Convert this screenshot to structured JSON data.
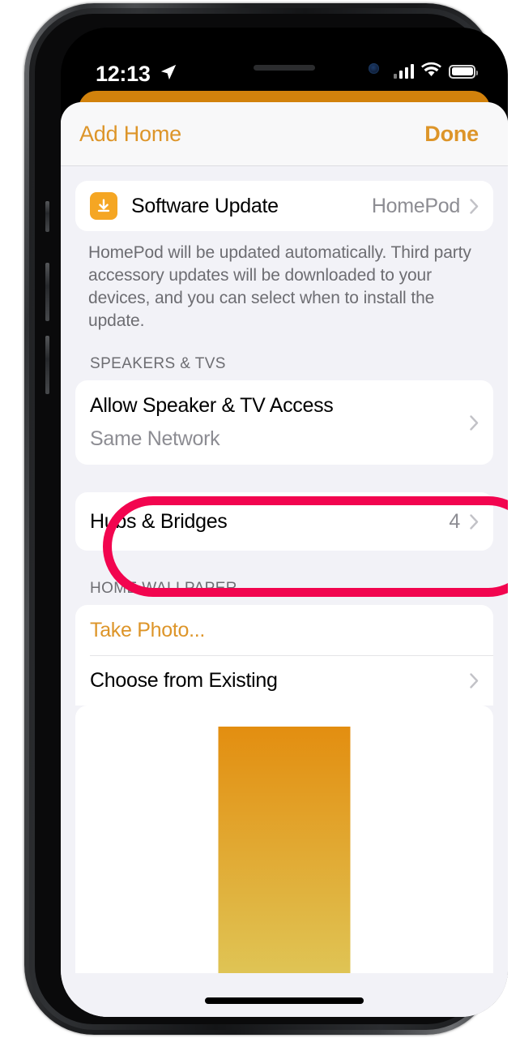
{
  "status_bar": {
    "time": "12:13",
    "location_icon": "location-arrow-icon",
    "signal_icon": "cellular-signal-icon",
    "signal_bars": 4,
    "wifi_icon": "wifi-icon",
    "battery_icon": "battery-full-icon"
  },
  "nav": {
    "title": "Add Home",
    "done_label": "Done"
  },
  "sections": [
    {
      "id": "software-update",
      "header": "",
      "rows": [
        {
          "title": "Software Update",
          "value": "HomePod",
          "icon": "software-update-download-icon",
          "chevron": true
        }
      ],
      "footer": "HomePod will be updated automatically. Third party accessory updates will be downloaded to your devices, and you can select when to install the update."
    },
    {
      "id": "speakers-and-tvs",
      "header": "SPEAKERS & TVS",
      "rows": [
        {
          "title": "Allow Speaker & TV Access",
          "subtitle": "Same Network",
          "chevron": true
        }
      ],
      "footer": ""
    },
    {
      "id": "hubs-and-bridges",
      "header": "",
      "rows": [
        {
          "title": "Hubs & Bridges",
          "value": "4",
          "chevron": true
        }
      ],
      "footer": ""
    },
    {
      "id": "home-wallpaper",
      "header": "HOME WALLPAPER",
      "rows": [
        {
          "title": "Take Photo...",
          "accent": true,
          "chevron": false
        },
        {
          "title": "Choose from Existing",
          "chevron": true
        }
      ],
      "footer": ""
    }
  ],
  "wallpaper_preview": {
    "name": "orange-gradient-wallpaper",
    "gradient_top": "#e38e10",
    "gradient_bottom": "#dfc556"
  },
  "annotation": {
    "name": "hubs-and-bridges-highlight",
    "color": "#f2054f",
    "shape": "rounded-rectangle"
  },
  "colors": {
    "accent": "#dd9529",
    "icon_orange": "#f5a623",
    "sheet_background": "#f2f2f7",
    "card_background": "#ffffff",
    "secondary_text": "#8d8d93",
    "header_text": "#6d6d72",
    "back_card_orange": "#d2820c"
  }
}
